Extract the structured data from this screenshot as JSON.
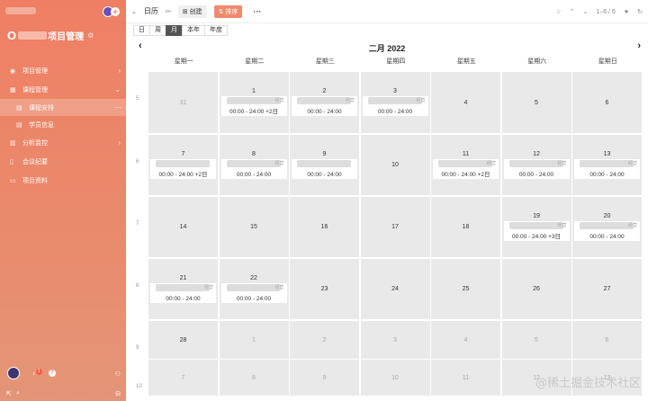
{
  "sidebar": {
    "logo": "O",
    "title": "项目管理",
    "menu": [
      {
        "label": "项目管理"
      },
      {
        "label": "课程管理"
      },
      {
        "label": "课程安排"
      },
      {
        "label": "学员信息"
      },
      {
        "label": "分析监控"
      },
      {
        "label": "会议纪要"
      },
      {
        "label": "项目资料"
      }
    ],
    "badge": "1"
  },
  "topbar": {
    "title": "日历",
    "create_label": "创建",
    "sort_label": "排序",
    "more": "···",
    "count": "1–6 / 6"
  },
  "views": [
    "日",
    "周",
    "月",
    "本年",
    "年度"
  ],
  "month": {
    "title": "二月 2022",
    "prev": "‹",
    "next": "›"
  },
  "weekdays": [
    "星期一",
    "星期二",
    "星期三",
    "星期四",
    "星期五",
    "星期六",
    "星期日"
  ],
  "weeks": [
    {
      "num": "5",
      "days": [
        "31",
        "1",
        "2",
        "3",
        "4",
        "5",
        "6"
      ]
    },
    {
      "num": "6",
      "days": [
        "7",
        "8",
        "9",
        "10",
        "11",
        "12",
        "13"
      ]
    },
    {
      "num": "7",
      "days": [
        "14",
        "15",
        "16",
        "17",
        "18",
        "19",
        "20"
      ]
    },
    {
      "num": "8",
      "days": [
        "21",
        "22",
        "23",
        "24",
        "25",
        "26",
        "27"
      ]
    },
    {
      "num": "9",
      "days": [
        "28",
        "1",
        "2",
        "3",
        "4",
        "5",
        "6"
      ]
    },
    {
      "num": "10",
      "days": [
        "7",
        "8",
        "9",
        "10",
        "11",
        "12",
        "13"
      ]
    }
  ],
  "events": {
    "time_full": "00:00 - 24:00",
    "time_plus2": "00:00 - 24:00 +2日",
    "time_plus3": "00:00 - 24:00 +3日",
    "tag": "经营"
  },
  "watermark": "@稀土掘金技术社区"
}
